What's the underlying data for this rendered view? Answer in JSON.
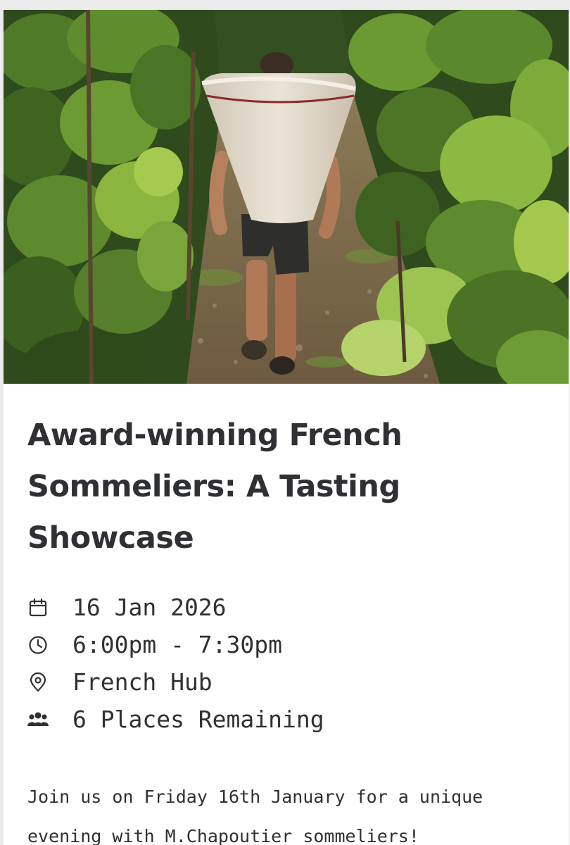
{
  "event": {
    "image_alt": "Grape picker carrying a harvest basket through vineyard rows",
    "title": "Award-winning French Sommeliers: A Tasting Showcase",
    "date": "16 Jan 2026",
    "time": "6:00pm - 7:30pm",
    "location": "French Hub",
    "places": "6 Places Remaining",
    "description": "Join us on Friday 16th January for a unique evening with M.Chapoutier sommeliers!"
  },
  "icons": {
    "date": "calendar-icon",
    "time": "clock-icon",
    "location": "map-pin-icon",
    "places": "users-icon"
  },
  "colors": {
    "text": "#2f3033",
    "foliage_dark": "#2f4a1c",
    "foliage_light": "#7fa83a",
    "basket": "#e6ded0"
  }
}
